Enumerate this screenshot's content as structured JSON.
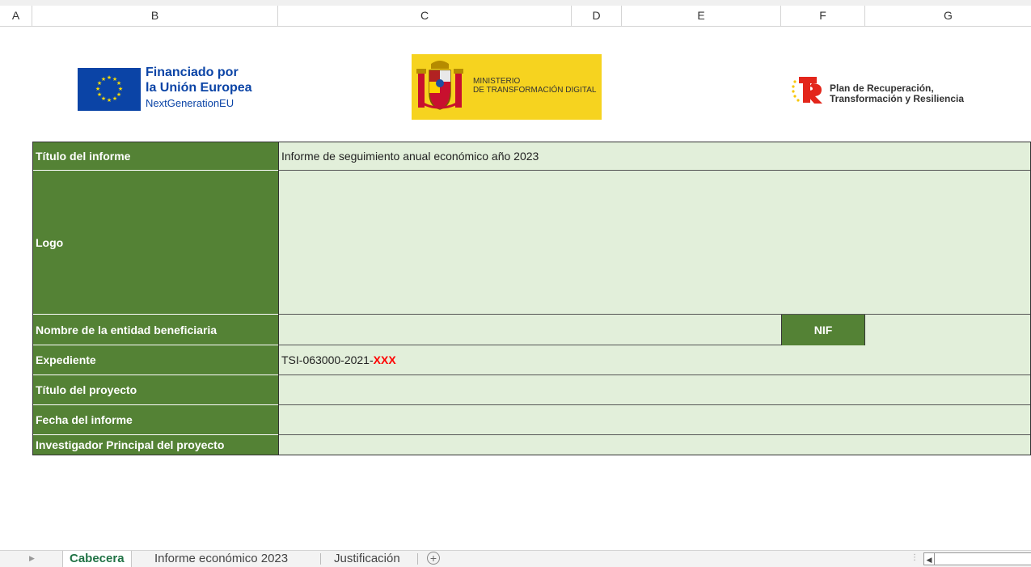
{
  "columns": [
    "A",
    "B",
    "C",
    "D",
    "E",
    "F",
    "G"
  ],
  "logos": {
    "eu": {
      "line1": "Financiado por",
      "line2": "la Unión Europea",
      "line3": "NextGenerationEU"
    },
    "ministry": {
      "line1": "MINISTERIO",
      "line2": "DE TRANSFORMACIÓN DIGITAL"
    },
    "prtr": {
      "line1": "Plan de Recuperación,",
      "line2": "Transformación y Resiliencia"
    }
  },
  "form": {
    "titulo_informe": {
      "label": "Título del informe",
      "value": "Informe de seguimiento anual económico año 2023"
    },
    "logo": {
      "label": "Logo",
      "value": ""
    },
    "entidad": {
      "label": "Nombre de la entidad beneficiaria",
      "value": "",
      "nif_label": "NIF",
      "nif_value": ""
    },
    "expediente": {
      "label": "Expediente",
      "value_prefix": "TSI-063000-2021-",
      "value_suffix": "XXX"
    },
    "titulo_proyecto": {
      "label": "Título del proyecto",
      "value": ""
    },
    "fecha": {
      "label": "Fecha del informe",
      "value": ""
    },
    "investigador": {
      "label": "Investigador Principal del proyecto",
      "value": ""
    }
  },
  "sheet_tabs": [
    {
      "label": "Cabecera",
      "active": true
    },
    {
      "label": "Informe económico 2023",
      "active": false
    },
    {
      "label": "Justificación",
      "active": false
    }
  ],
  "add_sheet_symbol": "+",
  "colors": {
    "label_green": "#548235",
    "value_green": "#e2efda",
    "accent_red": "#ff0000",
    "eu_blue": "#0b44a6",
    "ministry_yellow": "#f6d31f"
  }
}
